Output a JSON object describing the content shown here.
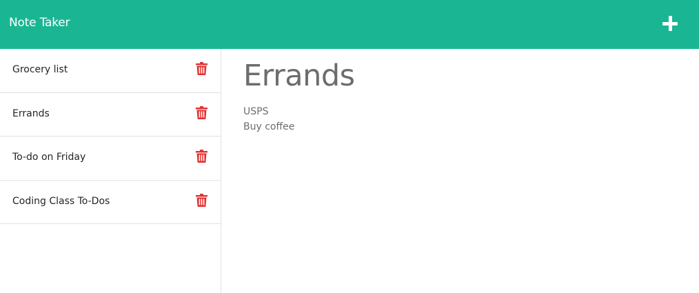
{
  "navbar": {
    "brand": "Note Taker",
    "new_note_icon": "plus-icon",
    "background": "#1ab694"
  },
  "sidebar": {
    "notes": [
      {
        "title": "Grocery list"
      },
      {
        "title": "Errands"
      },
      {
        "title": "To-do on Friday"
      },
      {
        "title": "Coding Class To-Dos"
      }
    ],
    "delete_icon": "trash-icon",
    "delete_color": "#e03131"
  },
  "active_note": {
    "title": "Errands",
    "lines": [
      "USPS",
      "Buy coffee"
    ]
  }
}
